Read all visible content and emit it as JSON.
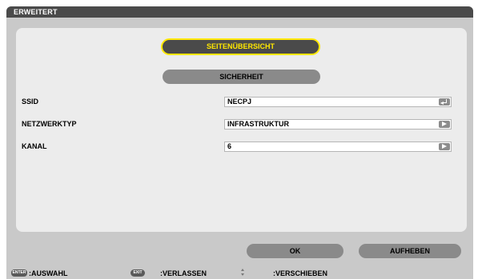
{
  "window": {
    "title": "ERWEITERT"
  },
  "tabs": {
    "overview": "SEITENÜBERSICHT",
    "security": "SICHERHEIT"
  },
  "fields": {
    "ssid": {
      "label": "SSID",
      "value": "NECPJ"
    },
    "network_type": {
      "label": "NETZWERKTYP",
      "value": "INFRASTRUKTUR"
    },
    "channel": {
      "label": "KANAL",
      "value": "6"
    }
  },
  "buttons": {
    "ok": "OK",
    "cancel": "AUFHEBEN"
  },
  "status_bar": {
    "enter_key": "ENTER",
    "enter_action": ":AUSWAHL",
    "exit_key": "EXIT",
    "exit_action": ":VERLASSEN",
    "move_action": ":VERSCHIEBEN"
  },
  "colors": {
    "highlight": "#ffe800",
    "titlebar": "#4a4a4a",
    "button_grey": "#8a8a8a"
  }
}
